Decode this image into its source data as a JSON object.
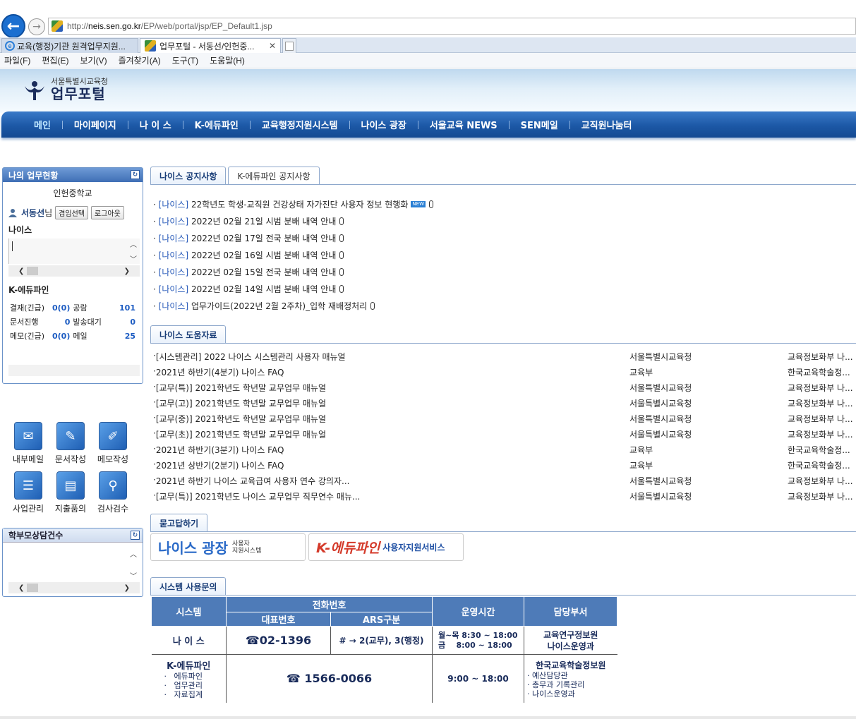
{
  "browser": {
    "url_prefix": "http://",
    "url_host": "neis.sen.go.kr",
    "url_path": "/EP/web/portal/jsp/EP_Default1.jsp",
    "tabs": [
      {
        "label": "교육(행정)기관 원격업무지원..."
      },
      {
        "label": "업무포털 - 서동선/인헌중...",
        "close": "✕"
      }
    ],
    "menu": [
      "파일(F)",
      "편집(E)",
      "보기(V)",
      "즐겨찾기(A)",
      "도구(T)",
      "도움말(H)"
    ]
  },
  "header": {
    "org": "서울특별시교육청",
    "title": "업무포털"
  },
  "gnb": [
    "메인",
    "마이페이지",
    "나 이 스",
    "K-에듀파인",
    "교육행정지원시스템",
    "나이스 광장",
    "서울교육 NEWS",
    "SEN메일",
    "교직원나눔터"
  ],
  "mywork": {
    "title": "나의 업무현황",
    "school": "인헌중학교",
    "user": "서동선",
    "user_suffix": "님",
    "btn_concurrent": "겸임선택",
    "btn_logout": "로그아웃",
    "neis_title": "나이스",
    "edufine_title": "K-에듀파인",
    "stats": [
      {
        "label": "결재(긴급)",
        "value": "0(0)",
        "label2": "공람",
        "value2": "101"
      },
      {
        "label": "문서진행",
        "value": "0",
        "label2": "발송대기",
        "value2": "0"
      },
      {
        "label": "메모(긴급)",
        "value": "0(0)",
        "label2": "메일",
        "value2": "25"
      }
    ]
  },
  "quick": [
    {
      "label": "내부메일",
      "icon": "mail-icon"
    },
    {
      "label": "문서작성",
      "icon": "document-write-icon"
    },
    {
      "label": "메모작성",
      "icon": "memo-pen-icon"
    },
    {
      "label": "사업관리",
      "icon": "project-icon"
    },
    {
      "label": "지출품의",
      "icon": "expense-icon"
    },
    {
      "label": "검사검수",
      "icon": "inspect-icon"
    }
  ],
  "parent": {
    "title": "학부모상담건수"
  },
  "notice_tabs": [
    "나이스 공지사항",
    "K-에듀파인 공지사항"
  ],
  "notices": [
    {
      "cat": "[나이스]",
      "text": "22학년도 학생-교직원 건강상태 자가진단 사용자 정보 현행화",
      "new": "NEW"
    },
    {
      "cat": "[나이스]",
      "text": "2022년 02월 21일 시범 분배 내역 안내"
    },
    {
      "cat": "[나이스]",
      "text": "2022년 02월 17일 전국 분배 내역 안내"
    },
    {
      "cat": "[나이스]",
      "text": "2022년 02월 16일 시범 분배 내역 안내"
    },
    {
      "cat": "[나이스]",
      "text": "2022년 02월 15일 전국 분배 내역 안내"
    },
    {
      "cat": "[나이스]",
      "text": "2022년 02월 14일 시범 분배 내역 안내"
    },
    {
      "cat": "[나이스]",
      "text": "업무가이드(2022년 2월 2주차)_입학 재배정처리"
    }
  ],
  "help_tab": "나이스 도움자료",
  "help": [
    {
      "title": "[시스템관리] 2022 나이스 시스템관리 사용자 매뉴얼",
      "org": "서울특별시교육청",
      "dept": "교육정보화부 나..."
    },
    {
      "title": "2021년 하반기(4분기) 나이스 FAQ",
      "org": "교육부",
      "dept": "한국교육학술정..."
    },
    {
      "title": "[교무(특)] 2021학년도 학년말 교무업무 매뉴얼",
      "org": "서울특별시교육청",
      "dept": "교육정보화부 나..."
    },
    {
      "title": "[교무(고)] 2021학년도 학년말 교무업무 매뉴얼",
      "org": "서울특별시교육청",
      "dept": "교육정보화부 나..."
    },
    {
      "title": "[교무(중)] 2021학년도 학년말 교무업무 매뉴얼",
      "org": "서울특별시교육청",
      "dept": "교육정보화부 나..."
    },
    {
      "title": "[교무(초)] 2021학년도 학년말 교무업무 매뉴얼",
      "org": "서울특별시교육청",
      "dept": "교육정보화부 나..."
    },
    {
      "title": "2021년 하반기(3분기) 나이스 FAQ",
      "org": "교육부",
      "dept": "한국교육학술정..."
    },
    {
      "title": "2021년 상반기(2분기) 나이스 FAQ",
      "org": "교육부",
      "dept": "한국교육학술정..."
    },
    {
      "title": "2021년 하반기 나이스 교육급여 사용자 연수 강의자...",
      "org": "서울특별시교육청",
      "dept": "교육정보화부 나..."
    },
    {
      "title": "[교무(특)] 2021학년도 나이스 교무업무 직무연수 매뉴...",
      "org": "서울특별시교육청",
      "dept": "교육정보화부 나..."
    }
  ],
  "qa": {
    "tab": "묻고답하기",
    "banner1_main": "나이스 광장",
    "banner1_sub1": "사용자",
    "banner1_sub2": "지원시스템",
    "banner2_main": "K-에듀파인",
    "banner2_sub": "사용자지원서비스"
  },
  "sys": {
    "tab": "시스템 사용문의",
    "h_system": "시스템",
    "h_phone": "전화번호",
    "h_main": "대표번호",
    "h_ars": "ARS구분",
    "h_hours": "운영시간",
    "h_dept": "담당부서",
    "neis": {
      "name": "나 이 스",
      "phone": "☎02-1396",
      "ars": "# → 2(교무), 3(행정)",
      "hours1": "월~목 8:30 ~ 18:00",
      "hours2": "금    8:00 ~ 18:00",
      "dept1": "교육연구정보원",
      "dept2": "나이스운영과"
    },
    "edufine": {
      "name": "K-에듀파인",
      "items": [
        "에듀파인",
        "업무관리",
        "자료집계"
      ],
      "phone": "☎ 1566-0066",
      "hours": "9:00 ~ 18:00",
      "dept": "한국교육학술정보원",
      "dept_items": [
        "예산담당관",
        "총무과 기록관리",
        "나이스운영과"
      ]
    }
  },
  "colors": {
    "gnb": "#1c58a6",
    "accent": "#2457b8",
    "table_head": "#4e7bb8"
  }
}
